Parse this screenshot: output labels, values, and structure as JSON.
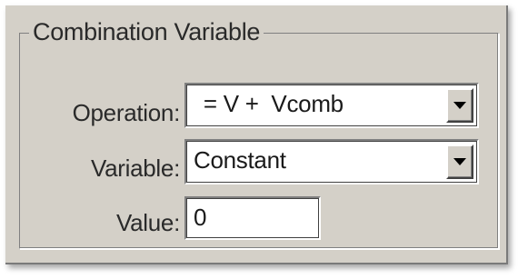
{
  "group": {
    "title": "Combination Variable"
  },
  "fields": {
    "operation": {
      "label": "Operation:",
      "value": " = V +  Vcomb"
    },
    "variable": {
      "label": "Variable:",
      "value": "Constant"
    },
    "value": {
      "label": "Value:",
      "value": "0"
    }
  },
  "icons": {
    "dropdown": "chevron-down-icon"
  }
}
